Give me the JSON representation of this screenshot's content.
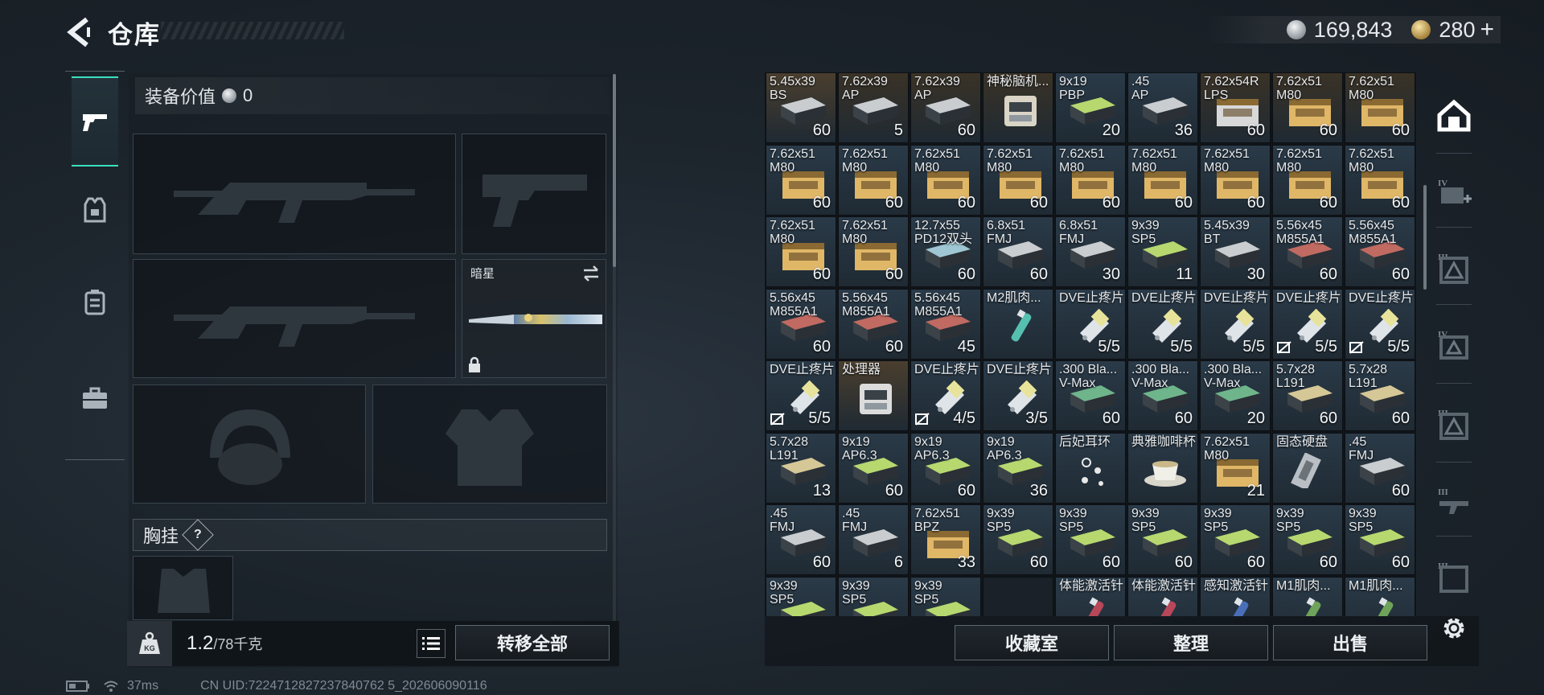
{
  "header": {
    "title": "仓库",
    "silver": "169,843",
    "gold": "280",
    "plus": "+"
  },
  "left_tabs": [
    {
      "name": "weapons",
      "icon": "pistol-icon"
    },
    {
      "name": "armor",
      "icon": "armor-vest-icon"
    },
    {
      "name": "rig",
      "icon": "backpack-icon"
    },
    {
      "name": "case",
      "icon": "briefcase-icon"
    }
  ],
  "equipment": {
    "value_label": "装备价值",
    "value": "0",
    "knife_name": "暗星",
    "rig_label": "胸挂",
    "rig_help": "?"
  },
  "bottom_left": {
    "weight": "1.2",
    "weight_cap": "/78千克",
    "transfer_all": "转移全部"
  },
  "status_bar": {
    "ping": "37ms",
    "uid": "CN UID:7224712827237840762 5_202606090116"
  },
  "inventory": {
    "rows": [
      [
        {
          "name": "5.45x39\nBS",
          "count": "60",
          "type": "ammo",
          "color": "#c9cdd0",
          "bg": "#4a3e2e"
        },
        {
          "name": "7.62x39\nAP",
          "count": "5",
          "type": "ammo",
          "color": "#c9cdd0",
          "bg": "#3a3226"
        },
        {
          "name": "7.62x39\nAP",
          "count": "60",
          "type": "ammo",
          "color": "#c9cdd0",
          "bg": "#3a3226"
        },
        {
          "name": "神秘脑机...",
          "count": "",
          "type": "device",
          "color": "#d9d4c6",
          "bg": "#3a3226"
        },
        {
          "name": "9x19\nPBP",
          "count": "20",
          "type": "ammo",
          "color": "#b7d86f",
          "bg": "#2a3a48"
        },
        {
          "name": ".45\nAP",
          "count": "36",
          "type": "ammo",
          "color": "#c9cdd0",
          "bg": "#2a3a48"
        },
        {
          "name": "7.62x54R\nLPS",
          "count": "60",
          "type": "crate",
          "color": "#d8d8d8",
          "bg": "#3a3226"
        },
        {
          "name": "7.62x51\nM80",
          "count": "60",
          "type": "crate",
          "color": "#e0b767",
          "bg": "#3a3226"
        },
        {
          "name": "7.62x51\nM80",
          "count": "60",
          "type": "crate",
          "color": "#e0b767",
          "bg": "#3a3226"
        }
      ],
      [
        {
          "name": "7.62x51\nM80",
          "count": "60",
          "type": "crate",
          "color": "#e0b767",
          "bg": "#2a3a48"
        },
        {
          "name": "7.62x51\nM80",
          "count": "60",
          "type": "crate",
          "color": "#e0b767",
          "bg": "#2a3a48"
        },
        {
          "name": "7.62x51\nM80",
          "count": "60",
          "type": "crate",
          "color": "#e0b767",
          "bg": "#2a3a48"
        },
        {
          "name": "7.62x51\nM80",
          "count": "60",
          "type": "crate",
          "color": "#e0b767",
          "bg": "#2a3a48"
        },
        {
          "name": "7.62x51\nM80",
          "count": "60",
          "type": "crate",
          "color": "#e0b767",
          "bg": "#2a3a48"
        },
        {
          "name": "7.62x51\nM80",
          "count": "60",
          "type": "crate",
          "color": "#e0b767",
          "bg": "#2a3a48"
        },
        {
          "name": "7.62x51\nM80",
          "count": "60",
          "type": "crate",
          "color": "#e0b767",
          "bg": "#2a3a48"
        },
        {
          "name": "7.62x51\nM80",
          "count": "60",
          "type": "crate",
          "color": "#e0b767",
          "bg": "#2a3a48"
        },
        {
          "name": "7.62x51\nM80",
          "count": "60",
          "type": "crate",
          "color": "#e0b767",
          "bg": "#2a3a48"
        }
      ],
      [
        {
          "name": "7.62x51\nM80",
          "count": "60",
          "type": "crate",
          "color": "#e0b767",
          "bg": "#2a3a48"
        },
        {
          "name": "7.62x51\nM80",
          "count": "60",
          "type": "crate",
          "color": "#e0b767",
          "bg": "#2a3a48"
        },
        {
          "name": "12.7x55\nPD12双头",
          "count": "60",
          "type": "ammo",
          "color": "#9fc7d3",
          "bg": "#2a3a48"
        },
        {
          "name": "6.8x51\nFMJ",
          "count": "60",
          "type": "ammo",
          "color": "#c9cdd0",
          "bg": "#2a3a48"
        },
        {
          "name": "6.8x51\nFMJ",
          "count": "30",
          "type": "ammo",
          "color": "#c9cdd0",
          "bg": "#2a3a48"
        },
        {
          "name": "9x39\nSP5",
          "count": "11",
          "type": "ammo",
          "color": "#b7d86f",
          "bg": "#2a3a48"
        },
        {
          "name": "5.45x39\nBT",
          "count": "30",
          "type": "ammo",
          "color": "#c9cdd0",
          "bg": "#2a3a48"
        },
        {
          "name": "5.56x45\nM855A1",
          "count": "60",
          "type": "ammo",
          "color": "#c06a62",
          "bg": "#2a3a48"
        },
        {
          "name": "5.56x45\nM855A1",
          "count": "60",
          "type": "ammo",
          "color": "#c06a62",
          "bg": "#2a3a48"
        }
      ],
      [
        {
          "name": "5.56x45\nM855A1",
          "count": "60",
          "type": "ammo",
          "color": "#c06a62",
          "bg": "#2a3a48"
        },
        {
          "name": "5.56x45\nM855A1",
          "count": "60",
          "type": "ammo",
          "color": "#c06a62",
          "bg": "#2a3a48"
        },
        {
          "name": "5.56x45\nM855A1",
          "count": "45",
          "type": "ammo",
          "color": "#c06a62",
          "bg": "#2a3a48"
        },
        {
          "name": "M2肌肉...",
          "count": "",
          "type": "injector",
          "color": "#55c0b0",
          "bg": "#2a3a48"
        },
        {
          "name": "DVE止疼片",
          "count": "5/5",
          "type": "pill",
          "color": "#e7e39a",
          "bg": "#2a3a48"
        },
        {
          "name": "DVE止疼片",
          "count": "5/5",
          "type": "pill",
          "color": "#e7e39a",
          "bg": "#2a3a48"
        },
        {
          "name": "DVE止疼片",
          "count": "5/5",
          "type": "pill",
          "color": "#e7e39a",
          "bg": "#2a3a48"
        },
        {
          "name": "DVE止疼片",
          "count": "5/5",
          "type": "pill",
          "color": "#e7e39a",
          "bg": "#2a3a48",
          "noreturn": true
        },
        {
          "name": "DVE止疼片",
          "count": "5/5",
          "type": "pill",
          "color": "#e7e39a",
          "bg": "#2a3a48",
          "noreturn": true
        }
      ],
      [
        {
          "name": "DVE止疼片",
          "count": "5/5",
          "type": "pill",
          "color": "#e7e39a",
          "bg": "#2a3a48",
          "noreturn": true
        },
        {
          "name": "处理器",
          "count": "",
          "type": "device",
          "color": "#dcdcdc",
          "bg": "#4a3e2e"
        },
        {
          "name": "DVE止疼片",
          "count": "4/5",
          "type": "pill",
          "color": "#e7e39a",
          "bg": "#2a3a48",
          "noreturn": true
        },
        {
          "name": "DVE止疼片",
          "count": "3/5",
          "type": "pill",
          "color": "#e7e39a",
          "bg": "#2a3a48"
        },
        {
          "name": ".300 Bla...\nV-Max",
          "count": "60",
          "type": "ammo",
          "color": "#6fb58c",
          "bg": "#2a3a48"
        },
        {
          "name": ".300 Bla...\nV-Max",
          "count": "60",
          "type": "ammo",
          "color": "#6fb58c",
          "bg": "#2a3a48"
        },
        {
          "name": ".300 Bla...\nV-Max",
          "count": "20",
          "type": "ammo",
          "color": "#6fb58c",
          "bg": "#2a3a48"
        },
        {
          "name": "5.7x28\nL191",
          "count": "60",
          "type": "ammo",
          "color": "#d6c797",
          "bg": "#2a3a48"
        },
        {
          "name": "5.7x28\nL191",
          "count": "60",
          "type": "ammo",
          "color": "#d6c797",
          "bg": "#2a3a48"
        }
      ],
      [
        {
          "name": "5.7x28\nL191",
          "count": "13",
          "type": "ammo",
          "color": "#d6c797",
          "bg": "#2a3a48"
        },
        {
          "name": "9x19\nAP6.3",
          "count": "60",
          "type": "ammo",
          "color": "#b7d86f",
          "bg": "#2a3a48"
        },
        {
          "name": "9x19\nAP6.3",
          "count": "60",
          "type": "ammo",
          "color": "#b7d86f",
          "bg": "#2a3a48"
        },
        {
          "name": "9x19\nAP6.3",
          "count": "36",
          "type": "ammo",
          "color": "#b7d86f",
          "bg": "#2a3a48"
        },
        {
          "name": "后妃耳环",
          "count": "",
          "type": "earring",
          "color": "#e8e8e8",
          "bg": "#2a3a48"
        },
        {
          "name": "典雅咖啡杯",
          "count": "",
          "type": "cup",
          "color": "#f0efe8",
          "bg": "#2a3a48"
        },
        {
          "name": "7.62x51\nM80",
          "count": "21",
          "type": "crate",
          "color": "#e0b767",
          "bg": "#2a3a48"
        },
        {
          "name": "固态硬盘",
          "count": "",
          "type": "ssd",
          "color": "#b9bfc4",
          "bg": "#2a3a48"
        },
        {
          "name": ".45\nFMJ",
          "count": "60",
          "type": "ammo",
          "color": "#c9cdd0",
          "bg": "#2a3a48"
        }
      ],
      [
        {
          "name": ".45\nFMJ",
          "count": "60",
          "type": "ammo",
          "color": "#c9cdd0",
          "bg": "#2a3a48"
        },
        {
          "name": ".45\nFMJ",
          "count": "6",
          "type": "ammo",
          "color": "#c9cdd0",
          "bg": "#2a3a48"
        },
        {
          "name": "7.62x51\nBPZ",
          "count": "33",
          "type": "crate",
          "color": "#e0b767",
          "bg": "#2a3a48"
        },
        {
          "name": "9x39\nSP5",
          "count": "60",
          "type": "ammo",
          "color": "#b7d86f",
          "bg": "#2a3a48"
        },
        {
          "name": "9x39\nSP5",
          "count": "60",
          "type": "ammo",
          "color": "#b7d86f",
          "bg": "#2a3a48"
        },
        {
          "name": "9x39\nSP5",
          "count": "60",
          "type": "ammo",
          "color": "#b7d86f",
          "bg": "#2a3a48"
        },
        {
          "name": "9x39\nSP5",
          "count": "60",
          "type": "ammo",
          "color": "#b7d86f",
          "bg": "#2a3a48"
        },
        {
          "name": "9x39\nSP5",
          "count": "60",
          "type": "ammo",
          "color": "#b7d86f",
          "bg": "#2a3a48"
        },
        {
          "name": "9x39\nSP5",
          "count": "60",
          "type": "ammo",
          "color": "#b7d86f",
          "bg": "#2a3a48"
        }
      ],
      [
        {
          "name": "9x39\nSP5",
          "count": "",
          "type": "ammo",
          "color": "#b7d86f",
          "bg": "#2a3a48"
        },
        {
          "name": "9x39\nSP5",
          "count": "",
          "type": "ammo",
          "color": "#b7d86f",
          "bg": "#2a3a48"
        },
        {
          "name": "9x39\nSP5",
          "count": "",
          "type": "ammo",
          "color": "#b7d86f",
          "bg": "#2a3a48"
        },
        {
          "name": "",
          "count": "",
          "type": "empty",
          "color": "#000",
          "bg": "#1a2128"
        },
        {
          "name": "体能激活针",
          "count": "",
          "type": "injector",
          "color": "#b8475a",
          "bg": "#2a3a48"
        },
        {
          "name": "体能激活针",
          "count": "",
          "type": "injector",
          "color": "#b8475a",
          "bg": "#2a3a48"
        },
        {
          "name": "感知激活针",
          "count": "",
          "type": "injector",
          "color": "#4a6fb8",
          "bg": "#2a3a48"
        },
        {
          "name": "M1肌肉...",
          "count": "",
          "type": "injector",
          "color": "#6fa35a",
          "bg": "#2a3a48"
        },
        {
          "name": "M1肌肉...",
          "count": "",
          "type": "injector",
          "color": "#6fa35a",
          "bg": "#2a3a48"
        }
      ]
    ]
  },
  "actions": {
    "collection": "收藏室",
    "organize": "整理",
    "sell": "出售"
  },
  "right_tabs": [
    {
      "icon": "home-shelter-icon",
      "label": ""
    },
    {
      "icon": "add-medical-case-icon",
      "label": "IV"
    },
    {
      "icon": "tier-3-case-icon",
      "label": "III"
    },
    {
      "icon": "tier-4-case-icon",
      "label": "IV"
    },
    {
      "icon": "tier-3-case-icon-2",
      "label": "III"
    },
    {
      "icon": "tier-3-weapon-case-icon",
      "label": "III"
    },
    {
      "icon": "tier-3-case-icon-3",
      "label": "III"
    }
  ]
}
